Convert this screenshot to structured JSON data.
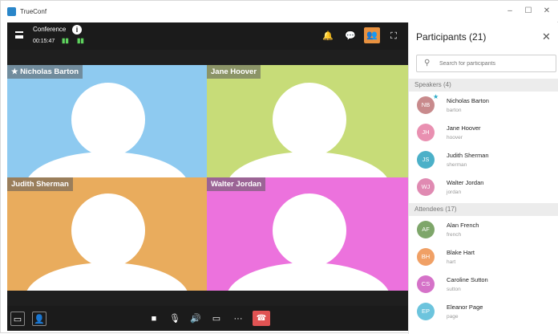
{
  "window": {
    "app_title": "TrueConf",
    "minimize": "–",
    "maximize": "☐",
    "close": "✕"
  },
  "conference": {
    "title": "Conference",
    "info": "i",
    "time": "00:15:47"
  },
  "toolbar_icons": {
    "bell": "🔔",
    "chat": "💬",
    "participants": "👥",
    "fullscreen": "⛶"
  },
  "tiles": [
    {
      "label": "★ Nicholas Barton",
      "color": "#8ecaf0"
    },
    {
      "label": "Jane Hoover",
      "color": "#c7dc78"
    },
    {
      "label": "Judith Sherman",
      "color": "#e9ac5d"
    },
    {
      "label": "Walter Jordan",
      "color": "#ec72dd"
    }
  ],
  "bottom_icons": {
    "chat": "▭",
    "presenter": "👤",
    "camera": "■",
    "mic": "🎙",
    "speaker": "🔊",
    "share": "▭",
    "more": "···",
    "hangup": "☎"
  },
  "panel": {
    "title": "Participants (21)",
    "close": "✕",
    "search_placeholder": "Search for participants",
    "speakers_header": "Speakers (4)",
    "attendees_header": "Attendees (17)",
    "speakers": [
      {
        "initials": "NB",
        "name": "Nicholas Barton",
        "login": "barton",
        "color": "#c88a8c",
        "owner": true
      },
      {
        "initials": "JH",
        "name": "Jane Hoover",
        "login": "hoover",
        "color": "#e990b1"
      },
      {
        "initials": "JS",
        "name": "Judith Sherman",
        "login": "sherman",
        "color": "#4bb0c8"
      },
      {
        "initials": "WJ",
        "name": "Walter Jordan",
        "login": "jordan",
        "color": "#e08ab2"
      }
    ],
    "attendees": [
      {
        "initials": "AF",
        "name": "Alan French",
        "login": "french",
        "color": "#7ea66a"
      },
      {
        "initials": "BH",
        "name": "Blake Hart",
        "login": "hart",
        "color": "#f0a065"
      },
      {
        "initials": "CS",
        "name": "Caroline Sutton",
        "login": "sutton",
        "color": "#d572c8"
      },
      {
        "initials": "EP",
        "name": "Eleanor Page",
        "login": "page",
        "color": "#6cc4dd"
      }
    ]
  }
}
